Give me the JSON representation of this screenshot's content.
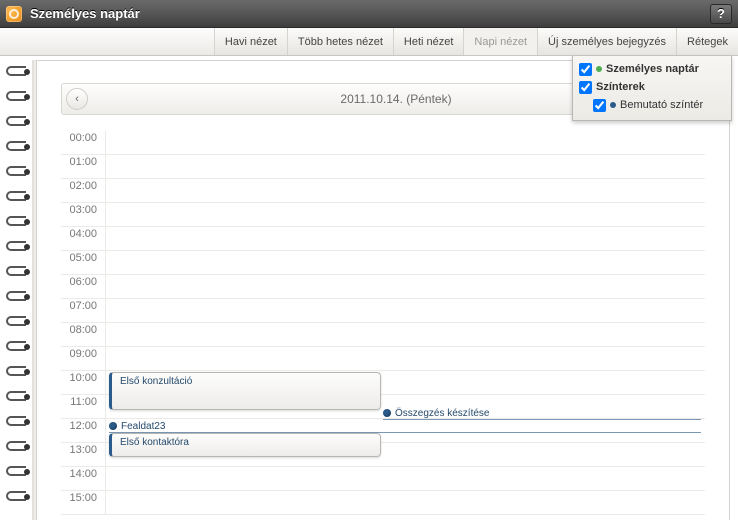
{
  "title": "Személyes naptár",
  "help": "?",
  "toolbar": {
    "month": "Havi nézet",
    "multiweek": "Több hetes nézet",
    "week": "Heti nézet",
    "day": "Napi nézet",
    "new_entry": "Új személyes bejegyzés",
    "layers": "Rétegek"
  },
  "date_header": {
    "nav_left": "‹",
    "text": "2011.10.14. (Péntek)"
  },
  "hours": [
    "00:00",
    "01:00",
    "02:00",
    "03:00",
    "04:00",
    "05:00",
    "06:00",
    "07:00",
    "08:00",
    "09:00",
    "10:00",
    "11:00",
    "12:00",
    "13:00",
    "14:00",
    "15:00"
  ],
  "events": {
    "e1": "Első konzultáció",
    "e2": "Összegzés készítése",
    "e3": "Fealdat23",
    "e4": "Első kontaktóra"
  },
  "layers_popup": {
    "personal": "Személyes naptár",
    "scenes": "Színterek",
    "demo_scene": "Bemutató színtér"
  }
}
